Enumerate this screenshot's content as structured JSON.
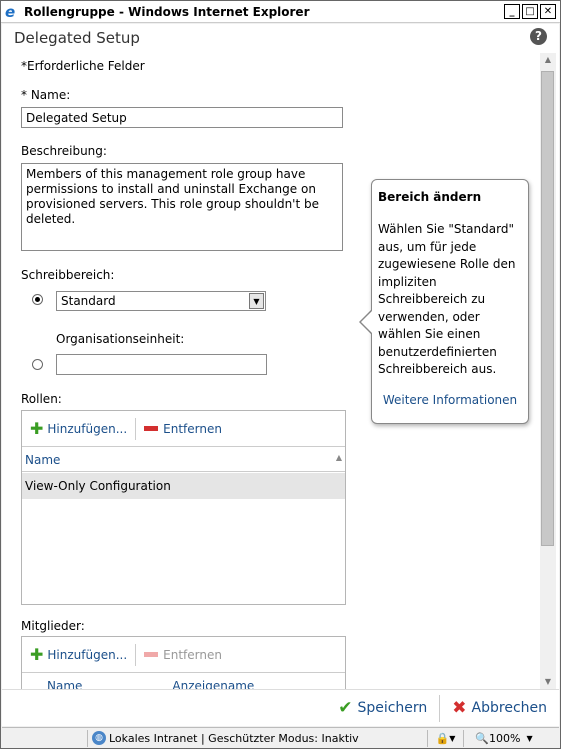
{
  "window": {
    "title": "Rollengruppe - Windows Internet Explorer"
  },
  "page": {
    "title": "Delegated Setup",
    "required_note": "*Erforderliche Felder"
  },
  "name_field": {
    "label": "* Name:",
    "value": "Delegated Setup"
  },
  "description": {
    "label": "Beschreibung:",
    "value": "Members of this management role group have permissions to install and uninstall Exchange on provisioned servers. This role group shouldn't be deleted."
  },
  "scope": {
    "label": "Schreibbereich:",
    "selected": "Standard",
    "ou_label": "Organisationseinheit:",
    "ou_value": ""
  },
  "roles": {
    "label": "Rollen:",
    "add_label": "Hinzufügen...",
    "remove_label": "Entfernen",
    "column_name": "Name",
    "rows": [
      "View-Only Configuration"
    ]
  },
  "members": {
    "label": "Mitglieder:",
    "add_label": "Hinzufügen...",
    "remove_label": "Entfernen",
    "column_name": "Name",
    "column_display": "Anzeigename"
  },
  "popup": {
    "title": "Bereich ändern",
    "body": "Wählen Sie \"Standard\" aus, um für jede zugewiesene Rolle den impliziten Schreibbereich zu verwenden, oder wählen Sie einen benutzerdefinierten Schreibbereich aus.",
    "link": "Weitere Informationen"
  },
  "actions": {
    "save": "Speichern",
    "cancel": "Abbrechen"
  },
  "statusbar": {
    "zone": "Lokales Intranet | Geschützter Modus: Inaktiv",
    "zoom": "100%"
  },
  "colors": {
    "link": "#1b4f8a",
    "add": "#3a9d23",
    "remove": "#d32f2f"
  }
}
